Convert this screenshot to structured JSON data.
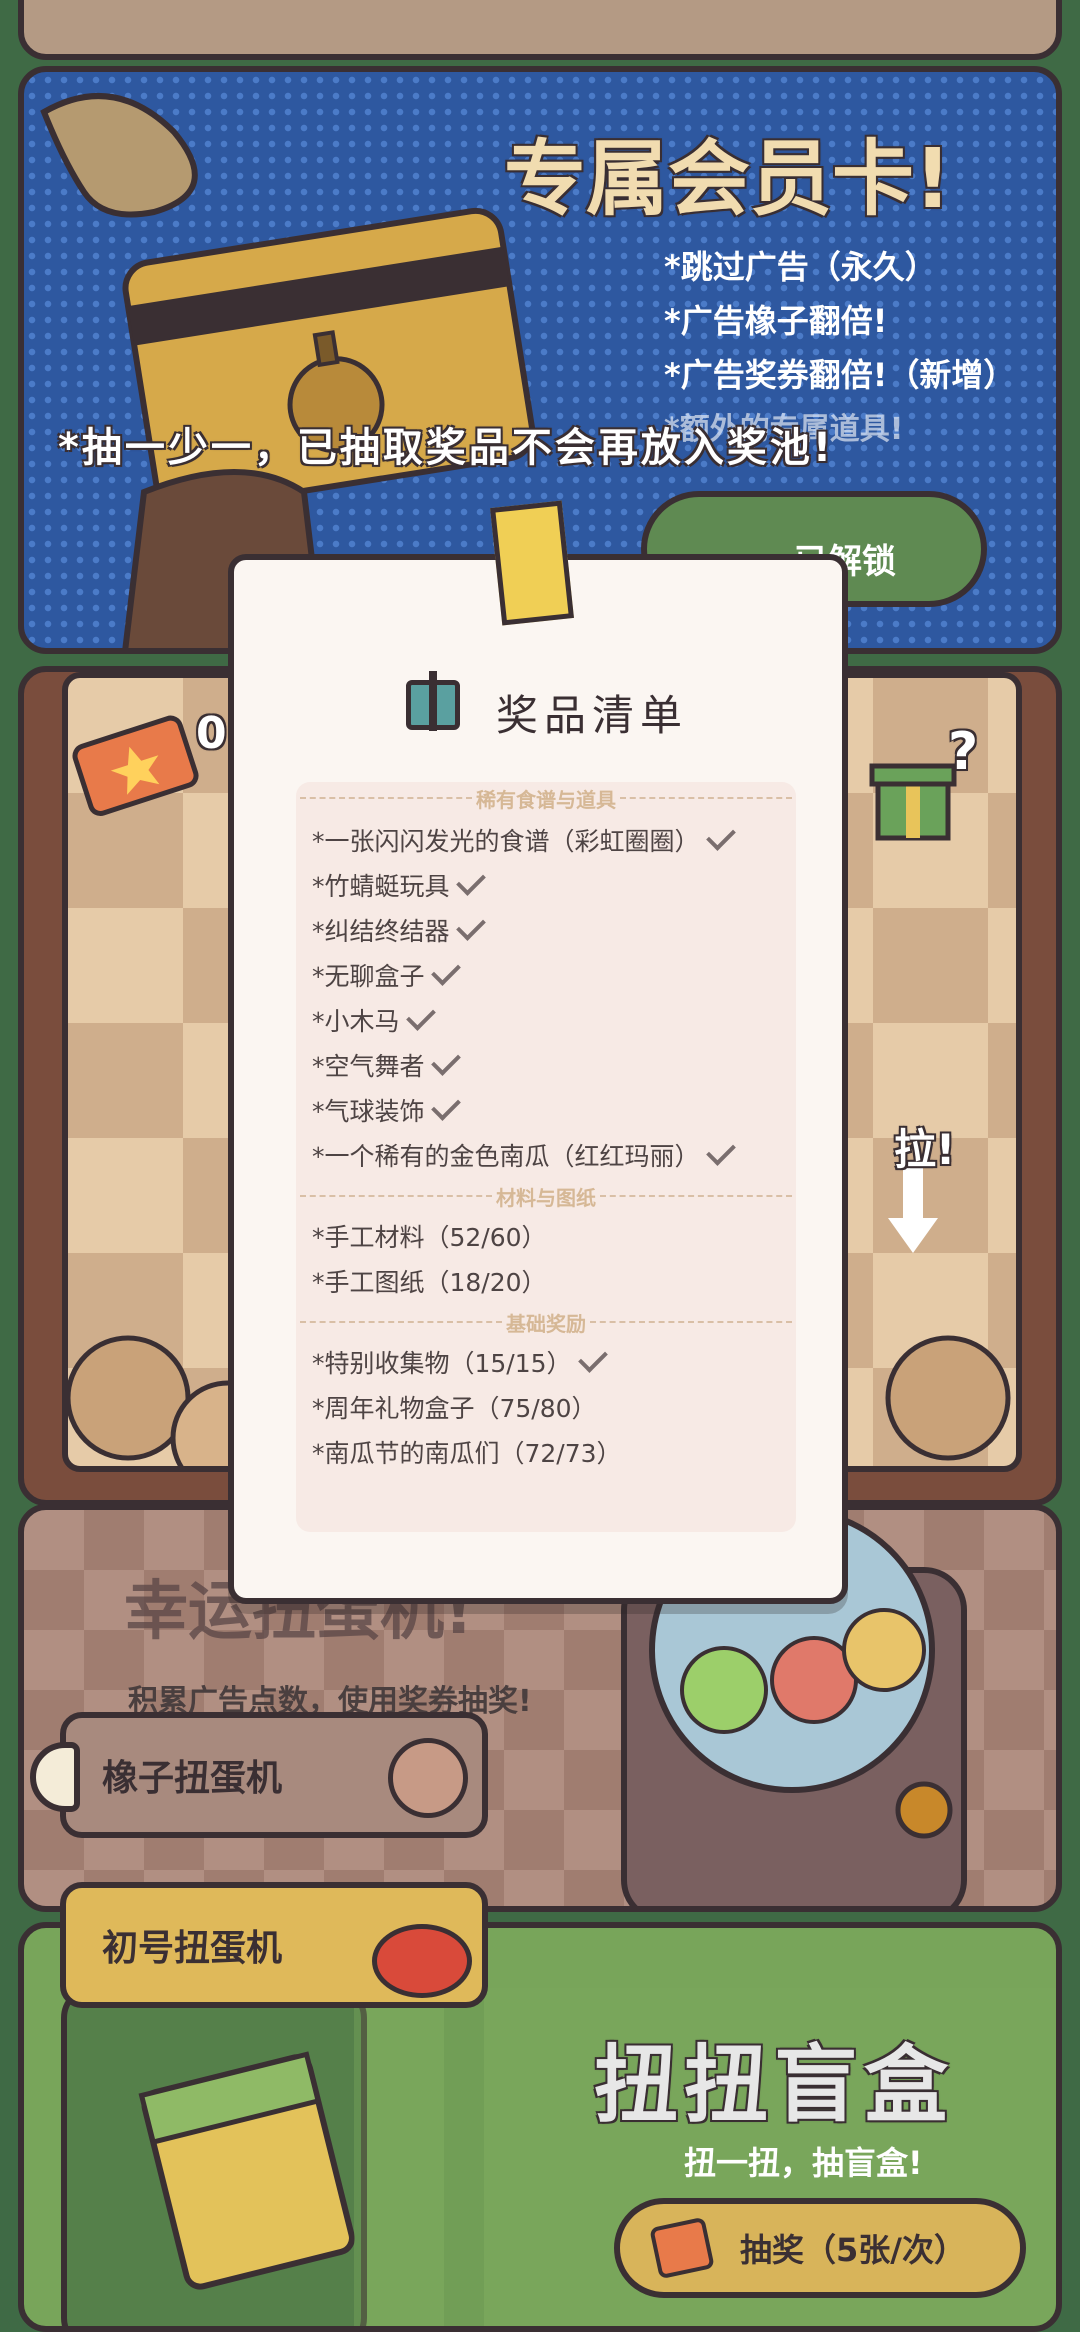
{
  "member_card": {
    "title": "专属会员卡!",
    "benefits": [
      "*跳过广告（永久）",
      "*广告橡子翻倍!",
      "*广告奖券翻倍!（新增）",
      "*额外的专属道具!"
    ],
    "unlock_button": "已解锁"
  },
  "notice": "*抽一少一，已抽取奖品不会再放入奖池!",
  "gacha": {
    "ticket_count": "0",
    "pull_label": "拉!"
  },
  "lucky": {
    "title": "幸运扭蛋机!",
    "subtitle": "积累广告点数，使用奖券抽奖!",
    "acorn_tab": "橡子扭蛋机",
    "first_tab": "初号扭蛋机"
  },
  "blind_box": {
    "title": "扭扭盲盒",
    "subtitle": "扭一扭，抽盲盒!",
    "draw_button": "抽奖（5张/次）"
  },
  "modal": {
    "title": "奖品清单",
    "sections": [
      {
        "title": "稀有食谱与道具",
        "items": [
          {
            "text": "*一张闪闪发光的食谱（彩虹圈圈）",
            "done": true
          },
          {
            "text": "*竹蜻蜓玩具",
            "done": true
          },
          {
            "text": "*纠结终结器",
            "done": true
          },
          {
            "text": "*无聊盒子",
            "done": true
          },
          {
            "text": "*小木马",
            "done": true
          },
          {
            "text": "*空气舞者",
            "done": true
          },
          {
            "text": "*气球装饰",
            "done": true
          },
          {
            "text": "*一个稀有的金色南瓜（红红玛丽）",
            "done": true
          }
        ]
      },
      {
        "title": "材料与图纸",
        "items": [
          {
            "text": "*手工材料（52/60）",
            "done": false
          },
          {
            "text": "*手工图纸（18/20）",
            "done": false
          }
        ]
      },
      {
        "title": "基础奖励",
        "items": [
          {
            "text": "*特别收集物（15/15）",
            "done": true
          },
          {
            "text": "*周年礼物盒子（75/80）",
            "done": false
          },
          {
            "text": "*南瓜节的南瓜们（72/73）",
            "done": false
          }
        ]
      }
    ]
  },
  "colors": {
    "member_blue": "#2e58a0",
    "gold": "#d9b35f",
    "blind_green": "#78a55a",
    "outline": "#3a2f33"
  }
}
